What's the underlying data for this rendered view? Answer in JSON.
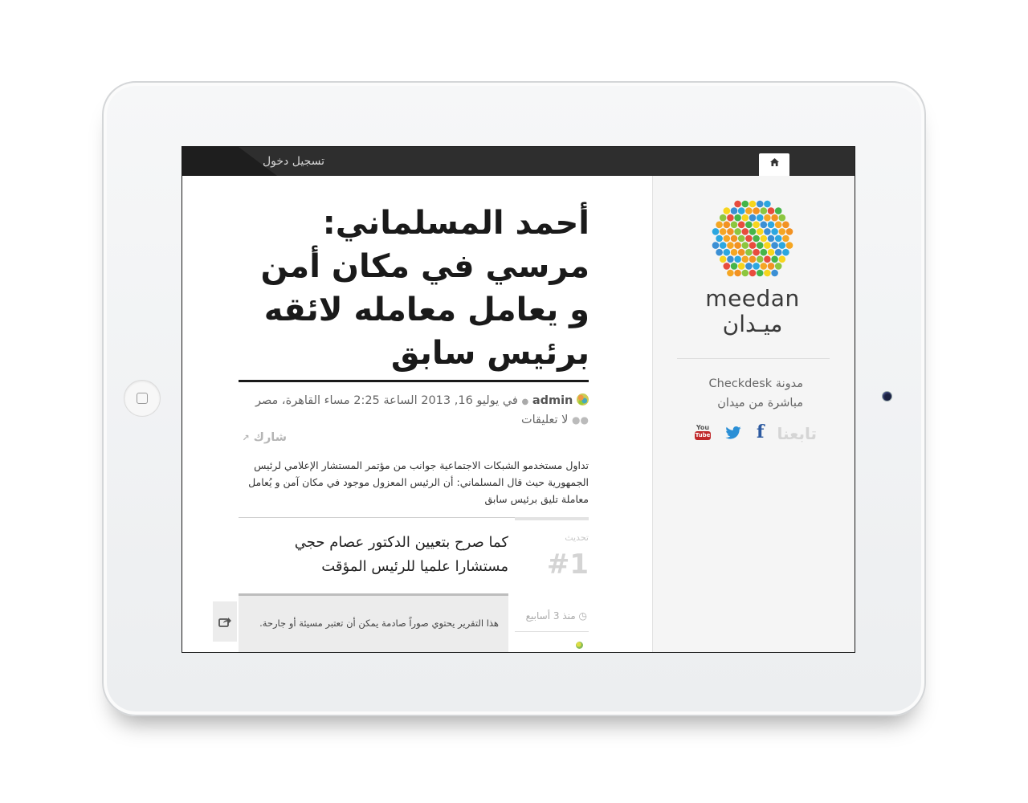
{
  "topbar": {
    "login_label": "تسجيل دخول",
    "home_icon": "home-icon"
  },
  "sidebar": {
    "logo": {
      "text_en": "meedan",
      "text_ar": "ميـدان"
    },
    "description": "مدونة Checkdesk مباشرة من ميدان",
    "follow_label": "تابعنا",
    "social": [
      {
        "name": "facebook",
        "icon": "facebook-icon",
        "glyph": "f",
        "color": "#2d5aa0"
      },
      {
        "name": "twitter",
        "icon": "twitter-icon",
        "color": "#2a8fd6"
      },
      {
        "name": "youtube",
        "icon": "youtube-icon",
        "you": "You",
        "tube": "Tube",
        "color": "#c0292b"
      }
    ]
  },
  "post": {
    "title": "أحمد المسلماني: مرسي في مكان أمن و يعامل معامله لائقه برئيس سابق",
    "author": "admin",
    "date": "في يوليو 16, 2013 الساعة 2:25 مساء القاهرة، مصر",
    "comments": "لا تعليقات",
    "share_label": "شارك",
    "body": "تداول مستخدمو الشبكات الاجتماعية جوانب من مؤتمر المستشار الإعلامي لرئيس الجمهورية حيث قال المسلماني: أن الرئيس المعزول موجود في مكان آمن و يُعامل معاملة تليق برئيس سابق"
  },
  "update": {
    "label": "تحديث",
    "number": "#1",
    "text": "كما صرح بتعيين الدكتور عصام حجي مستشارا علميا للرئيس المؤقت",
    "media_warning": "هذا التقرير يحتوي صوراً صادمة يمكن أن تعتبر مسيئة أو جارحة.",
    "time_ago": "منذ 3 أسابيع"
  },
  "colors": {
    "topbar": "#2e2e2e",
    "sidebar_bg": "#f5f5f5",
    "title_text": "#1a1a1a"
  }
}
